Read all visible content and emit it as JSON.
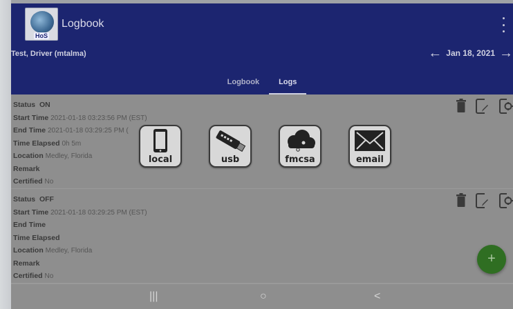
{
  "app": {
    "title": "Logbook",
    "logo_text": "HoS"
  },
  "header": {
    "driver": "Test, Driver (mtalma)",
    "date": "Jan 18, 2021",
    "tabs": [
      {
        "label": "Logbook",
        "active": false
      },
      {
        "label": "Logs",
        "active": true
      }
    ]
  },
  "logs": [
    {
      "status_label": "Status",
      "status_value": "ON",
      "start_label": "Start Time",
      "start_value": "2021-01-18 03:23:56 PM (EST)",
      "end_label": "End Time",
      "end_value": "2021-01-18 03:29:25 PM (",
      "elapsed_label": "Time Elapsed",
      "elapsed_value": "0h 5m",
      "location_label": "Location",
      "location_value": "Medley, Florida",
      "remark_label": "Remark",
      "remark_value": "",
      "certified_label": "Certified",
      "certified_value": "No"
    },
    {
      "status_label": "Status",
      "status_value": "OFF",
      "start_label": "Start Time",
      "start_value": "2021-01-18 03:29:25 PM (EST)",
      "end_label": "End Time",
      "end_value": "",
      "elapsed_label": "Time Elapsed",
      "elapsed_value": "",
      "location_label": "Location",
      "location_value": "Medley, Florida",
      "remark_label": "Remark",
      "remark_value": "",
      "certified_label": "Certified",
      "certified_value": "No"
    }
  ],
  "export_options": [
    {
      "label": "local",
      "icon": "phone-icon"
    },
    {
      "label": "usb",
      "icon": "usb-drive-icon"
    },
    {
      "label": "fmcsa",
      "icon": "cloud-icon"
    },
    {
      "label": "email",
      "icon": "envelope-icon"
    }
  ],
  "fab": {
    "symbol": "+"
  },
  "nav": {
    "recents": "|||",
    "home": "○",
    "back": "<"
  },
  "colors": {
    "appbar": "#1c2570",
    "overlay_gray": "#8e8e8e",
    "fab_green": "#2f6e22"
  }
}
